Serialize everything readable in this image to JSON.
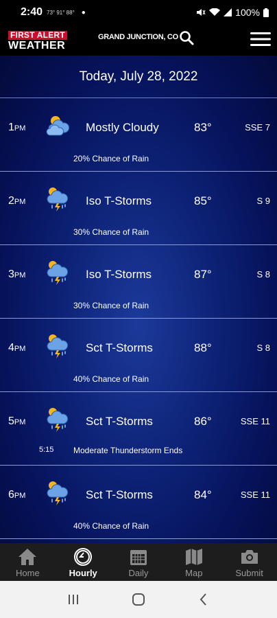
{
  "status_bar": {
    "time": "2:40",
    "temps": "73° 91° 88°",
    "battery": "100%"
  },
  "app_bar": {
    "logo_top": "FIRST ALERT",
    "logo_bottom": "WEATHER",
    "location": "GRAND JUNCTION, CO"
  },
  "main": {
    "date_header": "Today, July 28, 2022",
    "hours": [
      {
        "hour": "1",
        "ampm": "PM",
        "icon": "mostly-cloudy-icon",
        "condition": "Mostly Cloudy",
        "temp": "83°",
        "wind": "SSE 7",
        "rain": "20% Chance of Rain"
      },
      {
        "hour": "2",
        "ampm": "PM",
        "icon": "thunderstorm-icon",
        "condition": "Iso T-Storms",
        "temp": "85°",
        "wind": "S 9",
        "rain": "30% Chance of Rain"
      },
      {
        "hour": "3",
        "ampm": "PM",
        "icon": "thunderstorm-icon",
        "condition": "Iso T-Storms",
        "temp": "87°",
        "wind": "S 8",
        "rain": "30% Chance of Rain"
      },
      {
        "hour": "4",
        "ampm": "PM",
        "icon": "thunderstorm-icon",
        "condition": "Sct T-Storms",
        "temp": "88°",
        "wind": "S 8",
        "rain": "40% Chance of Rain"
      },
      {
        "hour": "5",
        "ampm": "PM",
        "icon": "thunderstorm-icon",
        "condition": "Sct T-Storms",
        "temp": "86°",
        "wind": "SSE 11",
        "event_time": "5:15",
        "event_text": "Moderate Thunderstorm Ends"
      },
      {
        "hour": "6",
        "ampm": "PM",
        "icon": "thunderstorm-icon",
        "condition": "Sct T-Storms",
        "temp": "84°",
        "wind": "SSE 11",
        "rain": "40% Chance of Rain"
      }
    ]
  },
  "tab_bar": {
    "items": [
      {
        "label": "Home",
        "icon": "home-icon"
      },
      {
        "label": "Hourly",
        "icon": "clock-icon",
        "active": true
      },
      {
        "label": "Daily",
        "icon": "calendar-icon"
      },
      {
        "label": "Map",
        "icon": "map-icon"
      },
      {
        "label": "Submit",
        "icon": "camera-icon"
      }
    ]
  }
}
